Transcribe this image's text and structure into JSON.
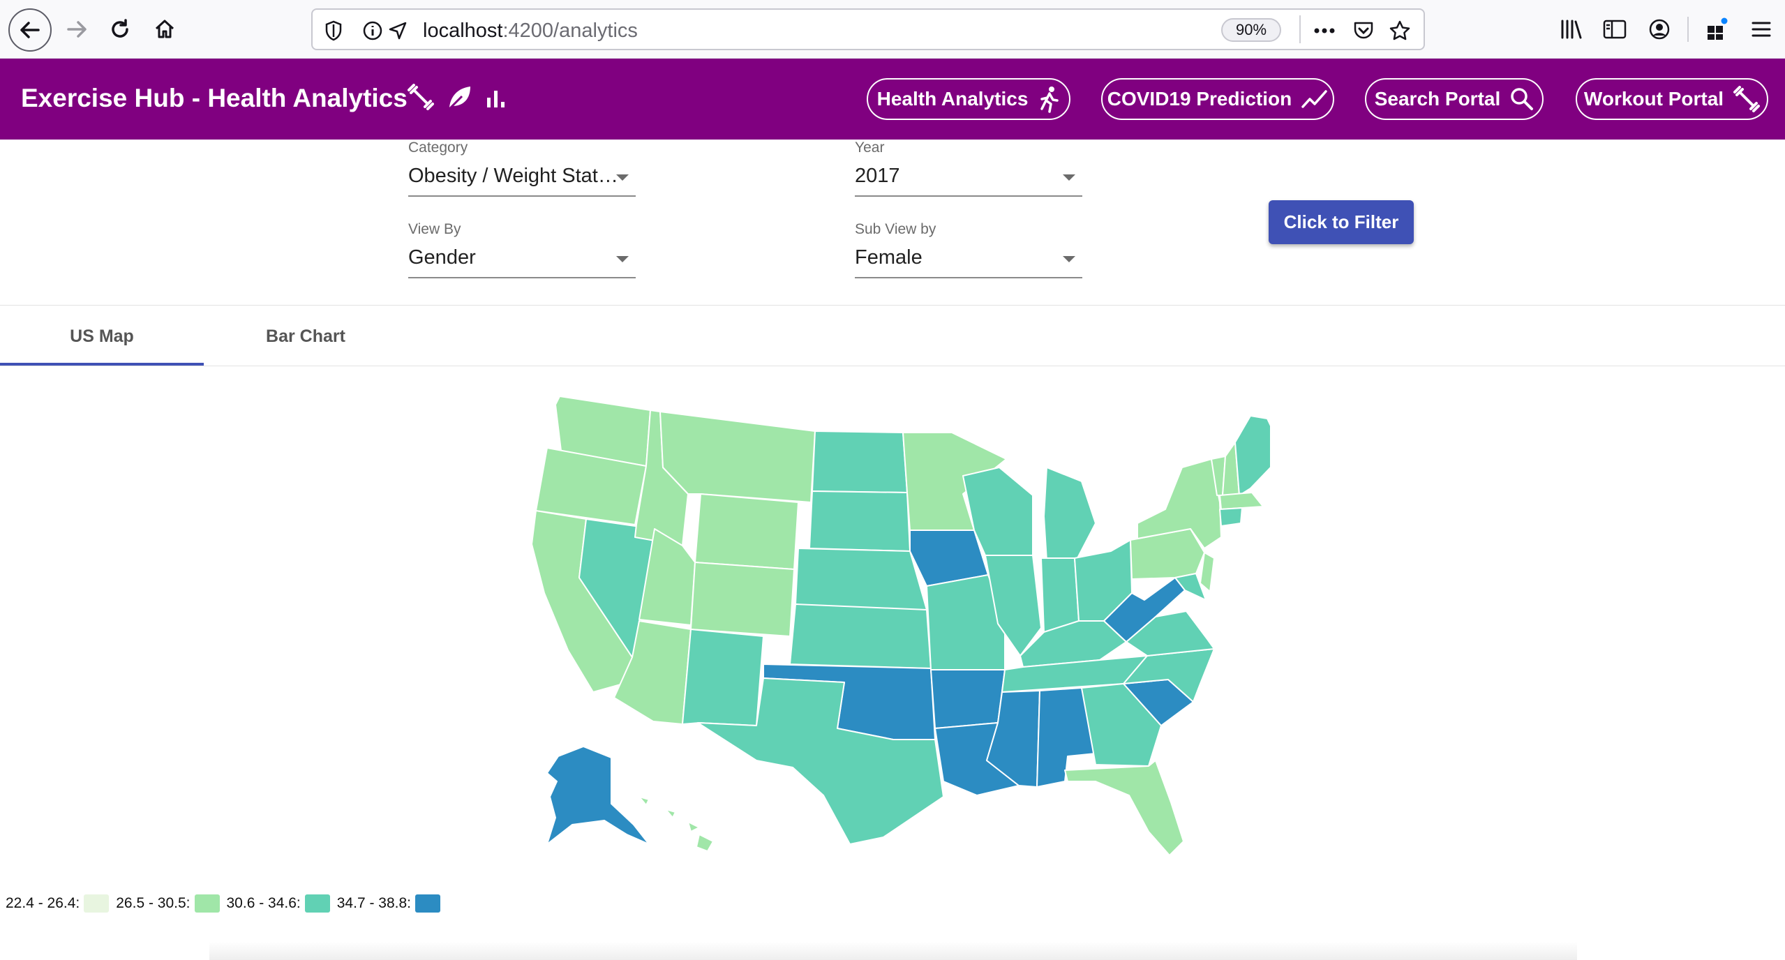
{
  "browser": {
    "url_host": "localhost",
    "url_path": ":4200/analytics",
    "zoom": "90%"
  },
  "header": {
    "title": "Exercise Hub - Health Analytics",
    "nav": [
      {
        "label": "Health Analytics",
        "icon": "running-icon"
      },
      {
        "label": "COVID19 Prediction",
        "icon": "trend-icon"
      },
      {
        "label": "Search Portal",
        "icon": "search-icon"
      },
      {
        "label": "Workout Portal",
        "icon": "dumbbell-icon"
      }
    ]
  },
  "filters": {
    "category": {
      "label": "Category",
      "value": "Obesity / Weight Stat…"
    },
    "year": {
      "label": "Year",
      "value": "2017"
    },
    "view_by": {
      "label": "View By",
      "value": "Gender"
    },
    "sub_view_by": {
      "label": "Sub View by",
      "value": "Female"
    },
    "submit_label": "Click to Filter"
  },
  "tabs": {
    "active": "US Map",
    "items": [
      "US Map",
      "Bar Chart"
    ]
  },
  "legend": [
    {
      "range": "22.4 - 26.4:",
      "color": "#e8f5e0"
    },
    {
      "range": "26.5 - 30.5:",
      "color": "#a0e6a8"
    },
    {
      "range": "30.6 - 34.6:",
      "color": "#61d1b4"
    },
    {
      "range": "34.7 - 38.8:",
      "color": "#2c8cc2"
    }
  ]
}
